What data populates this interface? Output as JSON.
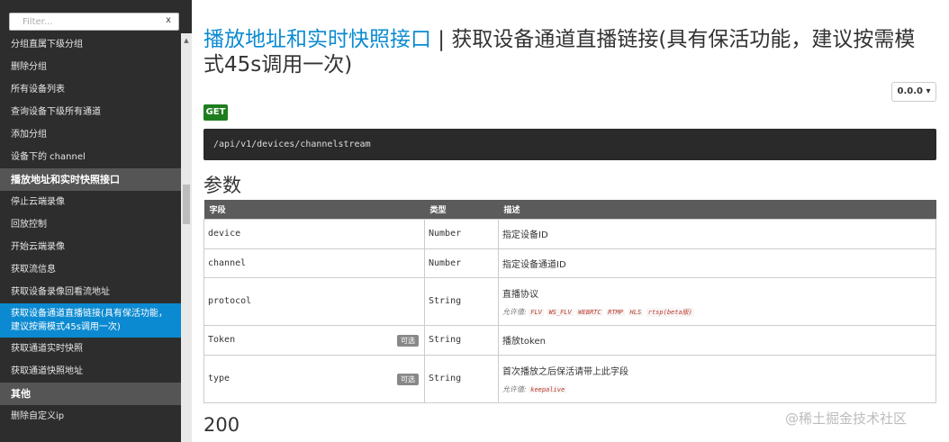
{
  "sidebar": {
    "filter_placeholder": "Filter...",
    "filter_clear": "x",
    "items": [
      {
        "label": "分组直属下级分组"
      },
      {
        "label": "删除分组"
      },
      {
        "label": "所有设备列表"
      },
      {
        "label": "查询设备下级所有通道"
      },
      {
        "label": "添加分组"
      },
      {
        "label": "设备下的 channel"
      }
    ],
    "group_live": "播放地址和实时快照接口",
    "live_items": [
      {
        "label": "停止云端录像"
      },
      {
        "label": "回放控制"
      },
      {
        "label": "开始云端录像"
      },
      {
        "label": "获取流信息"
      },
      {
        "label": "获取设备录像回看流地址"
      },
      {
        "label": "获取设备通道直播链接(具有保活功能，建议按需模式45s调用一次)"
      },
      {
        "label": "获取通道实时快照"
      },
      {
        "label": "获取通道快照地址"
      }
    ],
    "group_other": "其他",
    "other_items": [
      {
        "label": "删除自定义ip"
      }
    ]
  },
  "main": {
    "title_link": "播放地址和实时快照接口",
    "title_sep": " | ",
    "title_rest": "获取设备通道直播链接(具有保活功能，建议按需模式45s调用一次)",
    "version": "0.0.0 ▾",
    "method": "GET",
    "endpoint": "/api/v1/devices/channelstream",
    "params_heading": "参数",
    "table_headers": {
      "field": "字段",
      "type": "类型",
      "desc": "描述"
    },
    "params": [
      {
        "field": "device",
        "type": "Number",
        "desc": "指定设备ID"
      },
      {
        "field": "channel",
        "type": "Number",
        "desc": "指定设备通道ID"
      },
      {
        "field": "protocol",
        "type": "String",
        "desc": "直播协议",
        "allowed_label": "允许值:",
        "allowed": [
          "FLV",
          "WS_FLV",
          "WEBRTC",
          "RTMP",
          "HLS",
          "rtsp(beta版)"
        ]
      },
      {
        "field": "Token",
        "type": "String",
        "desc": "播放token",
        "optional": "可选"
      },
      {
        "field": "type",
        "type": "String",
        "desc": "首次播放之后保活请带上此字段",
        "optional": "可选",
        "allowed_label": "允许值:",
        "allowed": [
          "keepalive"
        ]
      }
    ],
    "response_heading": "200"
  },
  "watermark": "@稀土掘金技术社区",
  "colors": {
    "sidebar_bg": "#2d2d2d",
    "active": "#0b8ad1",
    "get_badge": "#1e7e1e",
    "endpoint_bg": "#2a2a2a"
  }
}
